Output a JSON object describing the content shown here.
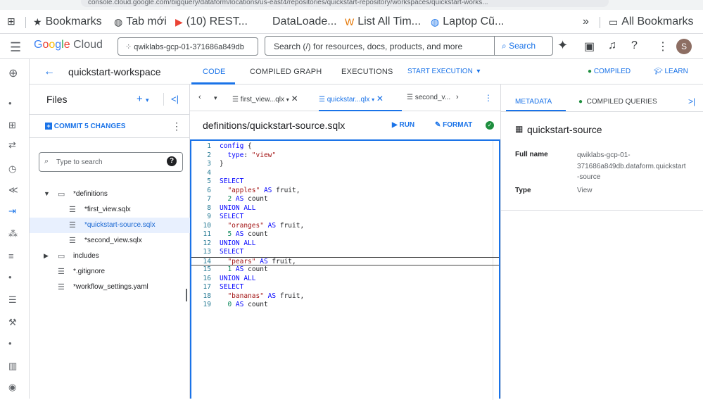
{
  "browser": {
    "url": "console.cloud.google.com/bigquery/dataform/locations/us-east4/repositories/quickstart-repository/workspaces/quickstart-works..."
  },
  "bookmarks": {
    "items": [
      {
        "icon": "star-icon",
        "label": "Bookmarks"
      },
      {
        "icon": "globe-icon",
        "label": "Tab mới"
      },
      {
        "icon": "youtube-icon",
        "label": "(10) REST..."
      },
      {
        "icon": "",
        "label": "DataLoade..."
      },
      {
        "icon": "wiki-icon",
        "label": "List All Tim..."
      },
      {
        "icon": "globe-icon",
        "label": "Laptop Cũ..."
      }
    ],
    "overflow": "»",
    "all_bookmarks": "All Bookmarks"
  },
  "header": {
    "logo_google": "Google",
    "logo_cloud": "Cloud",
    "project": "qwiklabs-gcp-01-371686a849db",
    "search_placeholder": "Search (/) for resources, docs, products, and more",
    "search_button": "Search",
    "avatar_letter": "S"
  },
  "workspace": {
    "title": "quickstart-workspace",
    "tabs": [
      "CODE",
      "COMPILED GRAPH",
      "EXECUTIONS"
    ],
    "start_execution": "START EXECUTION",
    "compiled": "COMPILED",
    "learn": "LEARN"
  },
  "files": {
    "title": "Files",
    "commit_label": "COMMIT 5 CHANGES",
    "search_placeholder": "Type to search",
    "tree": [
      {
        "type": "folder",
        "expanded": true,
        "label": "*definitions"
      },
      {
        "type": "file",
        "label": "*first_view.sqlx"
      },
      {
        "type": "file",
        "label": "*quickstart-source.sqlx",
        "selected": true
      },
      {
        "type": "file",
        "label": "*second_view.sqlx"
      },
      {
        "type": "folder",
        "expanded": false,
        "label": "includes"
      },
      {
        "type": "file",
        "label": "*.gitignore"
      },
      {
        "type": "file",
        "label": "*workflow_settings.yaml"
      }
    ]
  },
  "editor": {
    "tabs": [
      "first_view...qlx",
      "quickstar...qlx",
      "second_v..."
    ],
    "file_path": "definitions/quickstart-source.sqlx",
    "run": "RUN",
    "format": "FORMAT",
    "lines": [
      "config {",
      "  type: \"view\"",
      "}",
      "",
      "SELECT",
      "  \"apples\" AS fruit,",
      "  2 AS count",
      "UNION ALL",
      "SELECT",
      "  \"oranges\" AS fruit,",
      "  5 AS count",
      "UNION ALL",
      "SELECT",
      "  \"pears\" AS fruit,",
      "  1 AS count",
      "UNION ALL",
      "SELECT",
      "  \"bananas\" AS fruit,",
      "  0 AS count"
    ],
    "current_line": 14
  },
  "right_panel": {
    "tabs": [
      "METADATA",
      "COMPILED QUERIES"
    ],
    "title": "quickstart-source",
    "full_name_label": "Full name",
    "full_name_value": "qwiklabs-gcp-01-371686a849db.dataform.quickstart-source",
    "full_name_lines": [
      "qwiklabs-gcp-01-",
      "371686a849db.dataform.quickstart",
      "-source"
    ],
    "type_label": "Type",
    "type_value": "View"
  },
  "colors": {
    "accent": "#1a73e8",
    "success": "#1e8e3e",
    "selected_bg": "#e8f0fe"
  }
}
